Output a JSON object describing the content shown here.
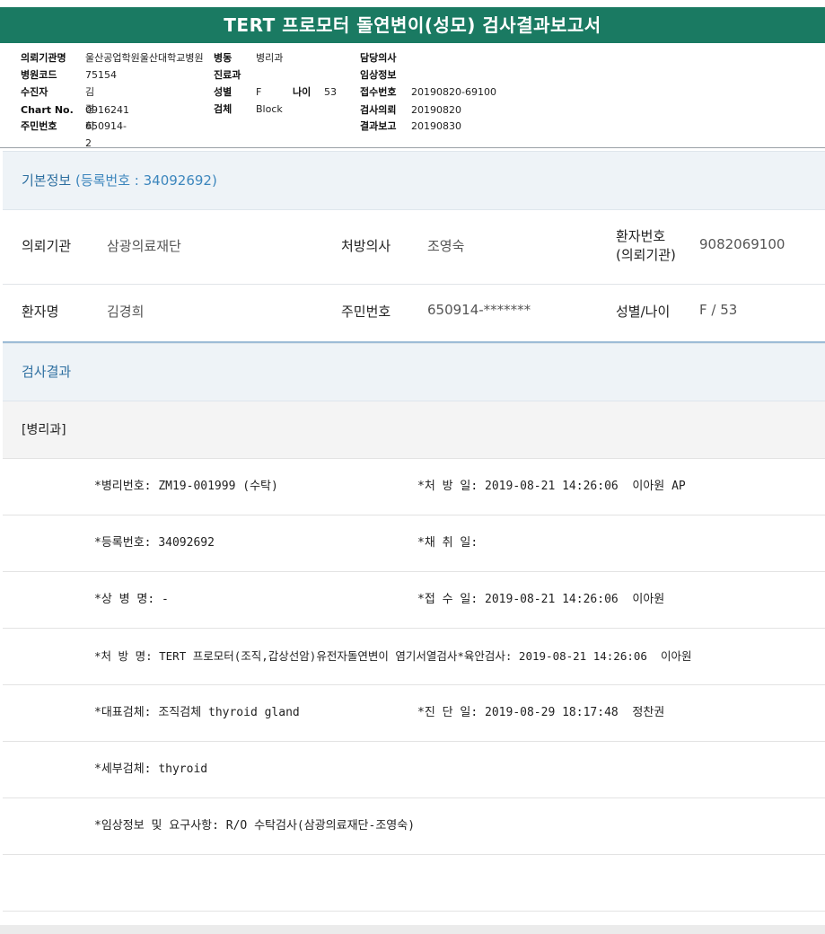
{
  "title": "TERT 프로모터 돌연변이(성모) 검사결과보고서",
  "meta": {
    "left": [
      {
        "label": "의뢰기관명",
        "value": "울산공업학원울산대학교병원"
      },
      {
        "label": "병원코드",
        "value": "75154"
      },
      {
        "label": "수진자",
        "value": "김경희"
      },
      {
        "label": "Chart No.",
        "value": "0916241"
      },
      {
        "label": "주민번호",
        "value": "650914-2"
      }
    ],
    "mid": [
      {
        "label": "병동",
        "value": "병리과"
      },
      {
        "label": "진료과",
        "value": ""
      },
      {
        "label": "성별",
        "value": "F"
      },
      {
        "label": "검체",
        "value": "Block"
      }
    ],
    "age": {
      "label": "나이",
      "value": "53"
    },
    "right": [
      {
        "label": "담당의사",
        "value": ""
      },
      {
        "label": "임상정보",
        "value": ""
      },
      {
        "label": "접수번호",
        "value": "20190820-69100"
      },
      {
        "label": "검사의뢰",
        "value": "20190820"
      },
      {
        "label": "결과보고",
        "value": "20190830"
      }
    ]
  },
  "basic": {
    "heading": "기본정보",
    "sub": "(등록번호 : 34092692)",
    "row1": {
      "l1": "의뢰기관",
      "v1": "삼광의료재단",
      "l2": "처방의사",
      "v2": "조영숙",
      "l3a": "환자번호",
      "l3b": "(의뢰기관)",
      "v3": "9082069100"
    },
    "row2": {
      "l1": "환자명",
      "v1": "김경희",
      "l2": "주민번호",
      "v2": "650914-*******",
      "l3": "성별/나이",
      "v3": "F / 53"
    }
  },
  "results": {
    "heading": "검사결과",
    "dept": "[병리과]",
    "rows": [
      {
        "c1": "*병리번호: ZM19-001999 (수탁)",
        "c2": "*처 방 일: 2019-08-21 14:26:06  이아원 AP"
      },
      {
        "c1": "*등록번호: 34092692",
        "c2": "*채 취 일:"
      },
      {
        "c1": "*상 병 명: -",
        "c2": "*접 수 일: 2019-08-21 14:26:06  이아원"
      },
      {
        "c1": "*처 방 명: TERT 프로모터(조직,갑상선암)유전자돌연변이 염기서열검사*육안검사: 2019-08-21 14:26:06  이아원",
        "c2": ""
      },
      {
        "c1": "*대표검체: 조직검체 thyroid gland",
        "c2": "*진 단 일: 2019-08-29 18:17:48  정찬권"
      },
      {
        "c1": "*세부검체: thyroid",
        "c2": ""
      },
      {
        "c1": "*임상정보 및 요구사항: R/O 수탁검사(삼광의료재단-조영숙)",
        "c2": ""
      },
      {
        "c1": "",
        "c2": ""
      }
    ]
  }
}
